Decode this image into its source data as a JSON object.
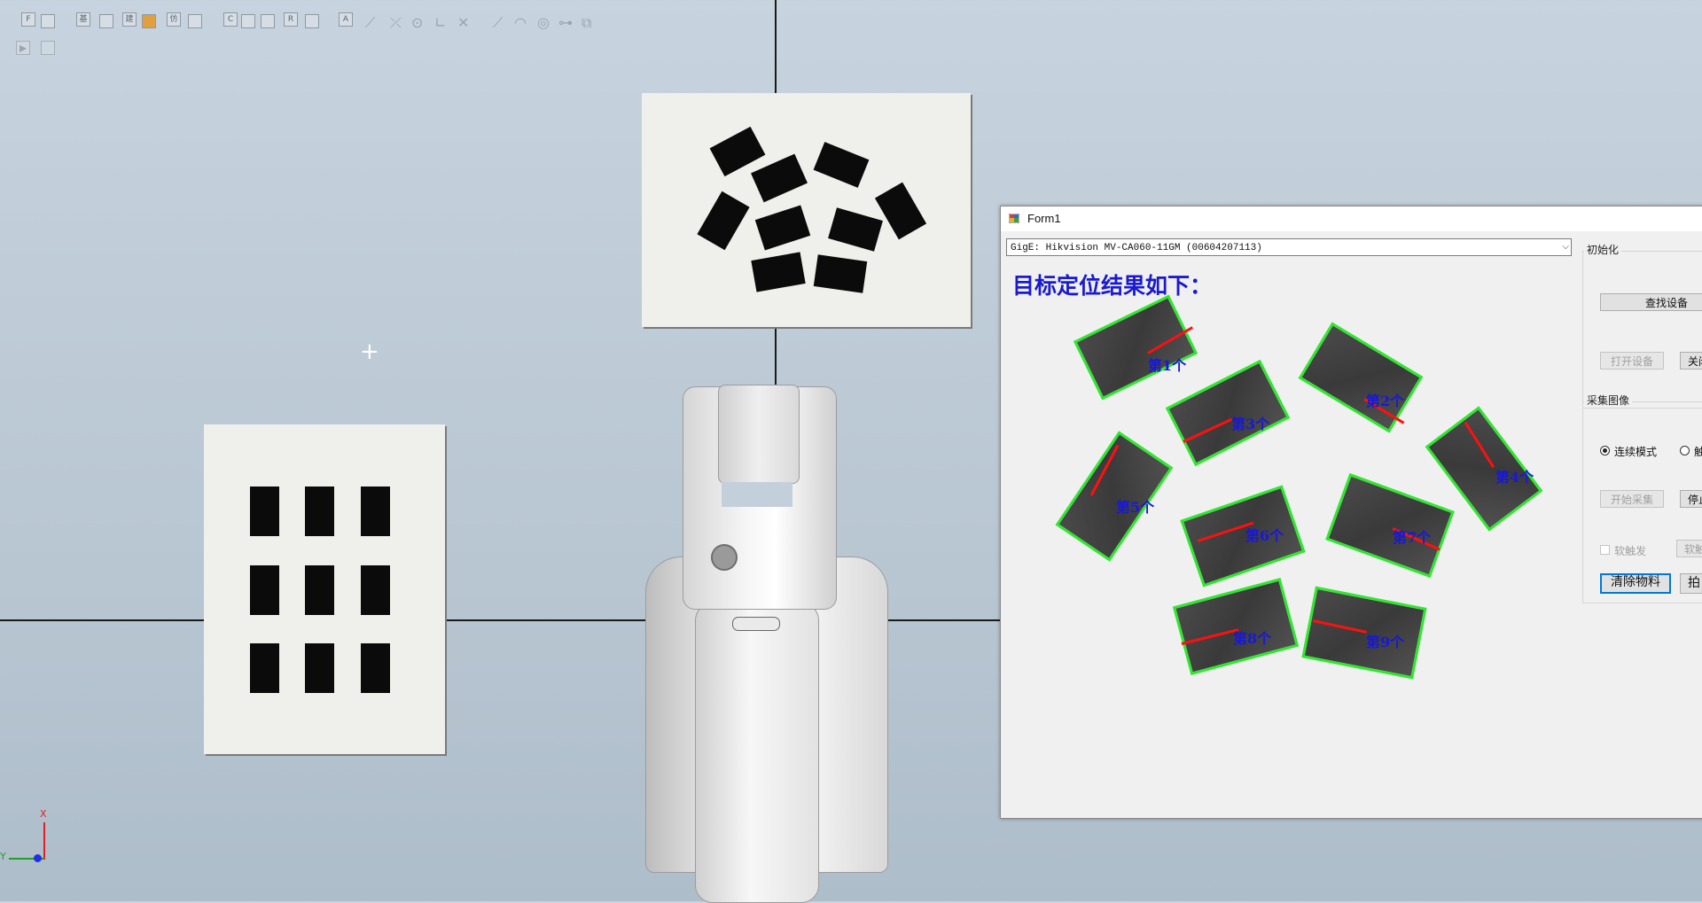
{
  "toolbar": {
    "icons": [
      "F",
      "",
      "基",
      "",
      "建",
      "",
      "仿",
      "",
      "C",
      "",
      "",
      "R",
      "",
      "A"
    ]
  },
  "scene": {
    "axis_indicator": {
      "x_label": "X",
      "y_label": "Y"
    }
  },
  "form": {
    "title": "Form1",
    "camera_select": "GigE: Hikvision MV-CA060-11GM (00604207113)",
    "result_heading": "目标定位结果如下：",
    "items": [
      {
        "label": "第1个"
      },
      {
        "label": "第2个"
      },
      {
        "label": "第3个"
      },
      {
        "label": "第4个"
      },
      {
        "label": "第5个"
      },
      {
        "label": "第6个"
      },
      {
        "label": "第7个"
      },
      {
        "label": "第8个"
      },
      {
        "label": "第9个"
      }
    ],
    "init_group": {
      "label": "初始化",
      "find_device": "查找设备",
      "open_device": "打开设备",
      "close_device": "关闭"
    },
    "capture_group": {
      "label": "采集图像",
      "continuous_mode": "连续模式",
      "trigger_mode": "触",
      "start_capture": "开始采集",
      "stop_capture": "停止",
      "soft_trigger_check": "软触发",
      "soft_trigger_button": "软触",
      "clear_material": "清除物料",
      "extra_button": "拍"
    }
  },
  "colors": {
    "detection_border": "#2ee82e",
    "orientation_line": "#ff1010",
    "label_blue": "#1818d8",
    "background": "#bfcbd7"
  }
}
